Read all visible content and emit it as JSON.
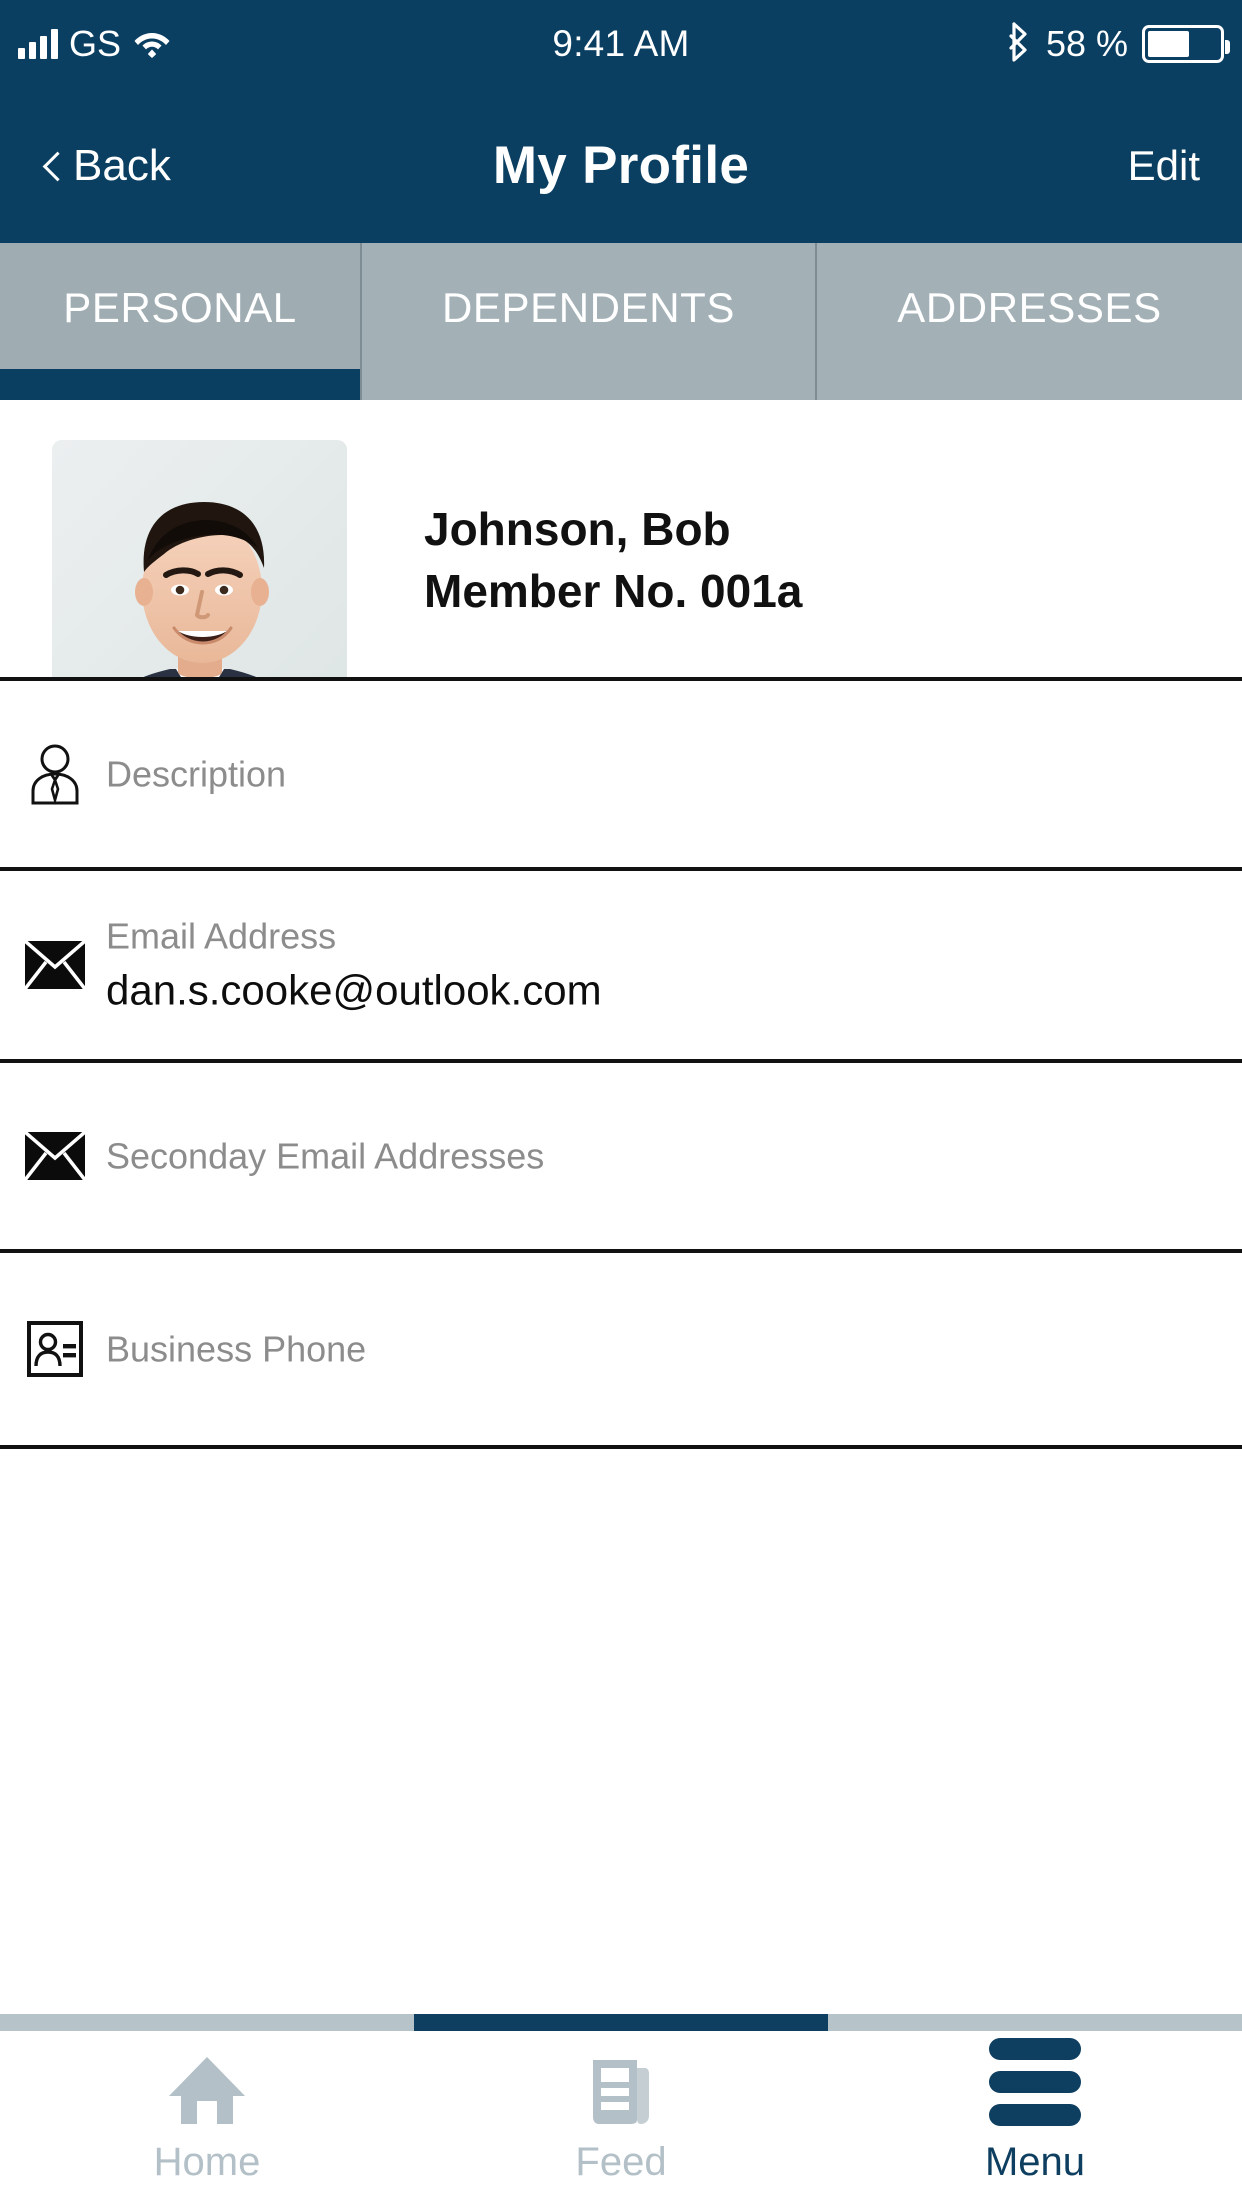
{
  "status_bar": {
    "carrier": "GS",
    "time": "9:41 AM",
    "battery_percent": "58 %",
    "signal_icon": "signal-bars-icon",
    "wifi_icon": "wifi-icon",
    "bluetooth_icon": "bluetooth-icon",
    "battery_icon": "battery-icon"
  },
  "nav": {
    "back_label": "Back",
    "title": "My Profile",
    "edit_label": "Edit"
  },
  "tabs": {
    "items": [
      {
        "label": "PERSONAL",
        "active": true
      },
      {
        "label": "DEPENDENTS",
        "active": false
      },
      {
        "label": "ADDRESSES",
        "active": false
      }
    ]
  },
  "profile": {
    "photo_alt": "profile-photo",
    "name": "Johnson, Bob",
    "member_no": "Member No. 001a"
  },
  "fields": [
    {
      "icon": "person-tie-icon",
      "label": "Description",
      "value": ""
    },
    {
      "icon": "envelope-icon",
      "label": "Email Address",
      "value": "dan.s.cooke@outlook.com"
    },
    {
      "icon": "envelope-icon",
      "label": "Seconday Email Addresses",
      "value": ""
    },
    {
      "icon": "contact-card-icon",
      "label": "Business Phone",
      "value": ""
    }
  ],
  "bottom_nav": {
    "items": [
      {
        "label": "Home",
        "icon": "home-icon",
        "active": false
      },
      {
        "label": "Feed",
        "icon": "newspaper-icon",
        "active": false
      },
      {
        "label": "Menu",
        "icon": "hamburger-icon",
        "active": true
      }
    ]
  },
  "colors": {
    "brand_dark_blue": "#0a3f62",
    "tab_gray": "#a3b1b7",
    "label_gray": "#8c8c8c",
    "inactive_nav_gray": "#b3c0c7"
  }
}
